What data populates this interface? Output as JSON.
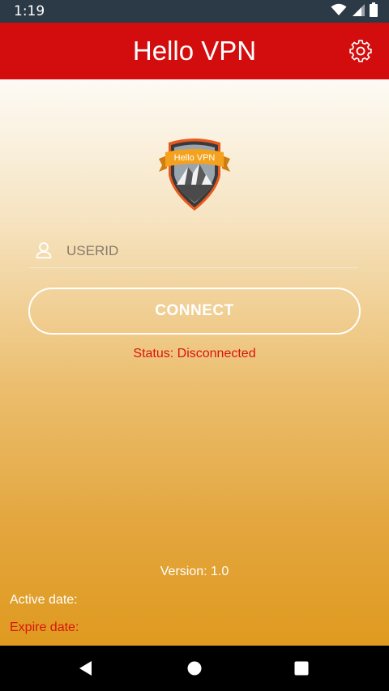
{
  "status_bar": {
    "time": "1:19",
    "icons": [
      "wifi-icon",
      "signal-icon",
      "battery-icon"
    ]
  },
  "app_bar": {
    "title": "Hello VPN",
    "settings_icon": "gear-icon"
  },
  "logo": {
    "text": "Hello VPN"
  },
  "login": {
    "userid_placeholder": "USERID",
    "userid_value": "",
    "connect_label": "CONNECT"
  },
  "status": {
    "text": "Status: Disconnected"
  },
  "footer": {
    "version": "Version: 1.0",
    "active_date": "Active date:",
    "expire_date": "Expire date:"
  },
  "nav": {
    "buttons": [
      "back-icon",
      "home-icon",
      "recents-icon"
    ]
  },
  "colors": {
    "app_bar": "#d30d0d",
    "status_red": "#d9150c",
    "gradient_bottom": "#df9a1f",
    "status_bar": "#2b3a46"
  }
}
